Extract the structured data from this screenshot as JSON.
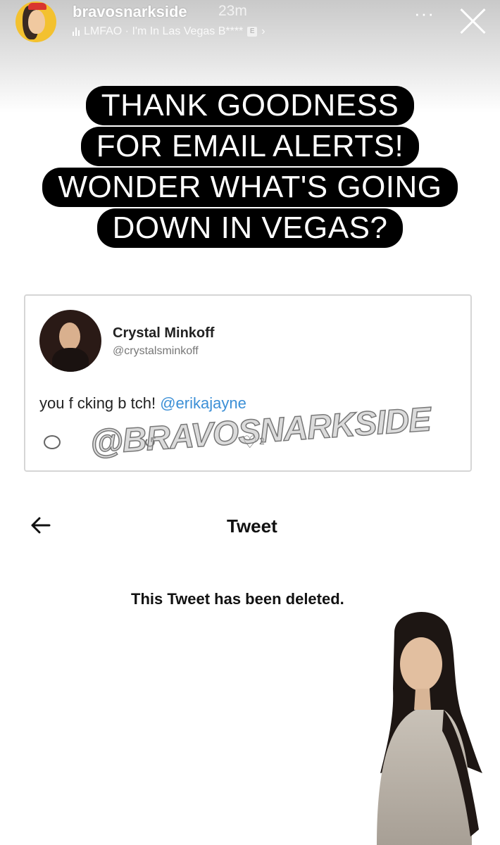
{
  "story": {
    "username": "bravosnarkside",
    "time": "23m",
    "music": "LMFAO · I'm In Las Vegas B****",
    "explicit": "E",
    "more": "···"
  },
  "caption": {
    "lines": [
      "THANK GOODNESS",
      "FOR EMAIL ALERTS!",
      "WONDER WHAT'S GOING",
      "DOWN IN VEGAS?"
    ]
  },
  "tweet": {
    "name": "Crystal Minkoff",
    "handle": "@crystalsminkoff",
    "text": "you f  cking b tch!",
    "mention": "@erikajayne",
    "like_count": "2"
  },
  "watermark": "@BRAVOSNARKSIDE",
  "deleted_page": {
    "title": "Tweet",
    "message": "This Tweet has been deleted."
  },
  "colors": {
    "caption_bg": "#000000",
    "mention": "#3b8fd6"
  }
}
